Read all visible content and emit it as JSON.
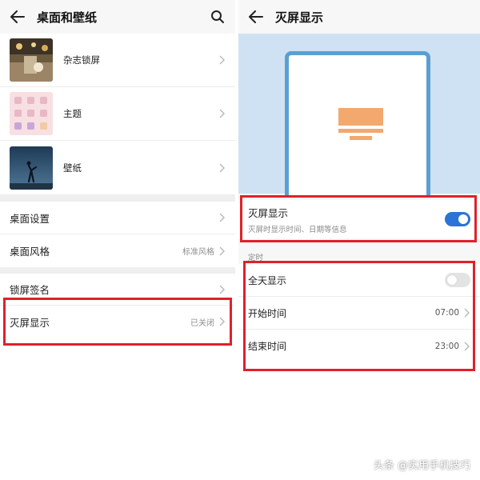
{
  "left": {
    "header": {
      "title": "桌面和壁纸",
      "back_icon": "arrow-left-icon",
      "search_icon": "search-icon"
    },
    "thumb_items": [
      {
        "label": "杂志锁屏"
      },
      {
        "label": "主题"
      },
      {
        "label": "壁纸"
      }
    ],
    "desktop": [
      {
        "label": "桌面设置",
        "value": ""
      },
      {
        "label": "桌面风格",
        "value": "标准风格"
      }
    ],
    "lock": [
      {
        "label": "锁屏签名",
        "value": ""
      },
      {
        "label": "灭屏显示",
        "value": "已关闭"
      }
    ]
  },
  "right": {
    "header": {
      "title": "灭屏显示",
      "back_icon": "arrow-left-icon"
    },
    "aod": {
      "title": "灭屏显示",
      "subtitle": "灭屏时显示时间、日期等信息",
      "enabled": true
    },
    "schedule_label": "定时",
    "schedule": [
      {
        "label": "全天显示",
        "toggle": false
      },
      {
        "label": "开始时间",
        "value": "07:00"
      },
      {
        "label": "结束时间",
        "value": "23:00"
      }
    ]
  },
  "watermark": "头条 @实用手机技巧",
  "colors": {
    "accent": "#2b73d6",
    "highlight": "#e0202a",
    "preview_bg": "#cfe2f3",
    "phone_frame": "#5b9fd2",
    "clock": "#f3a86d"
  }
}
